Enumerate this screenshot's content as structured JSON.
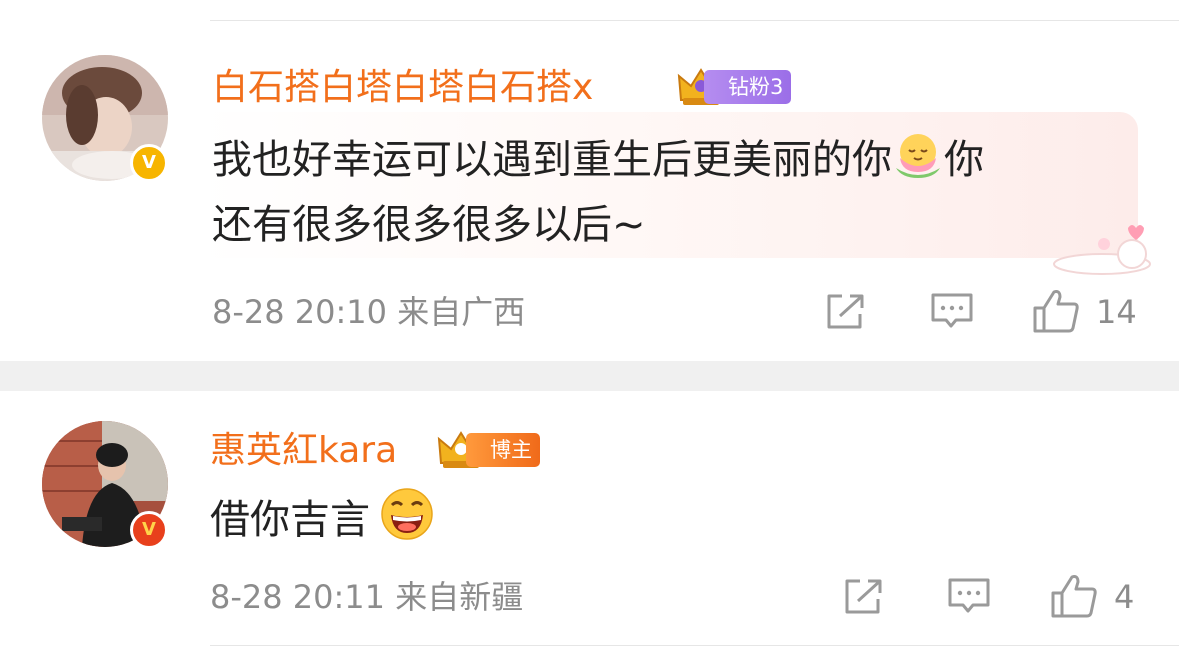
{
  "comments": [
    {
      "username": "白石搭白塔白塔白石搭x",
      "badge_label": "钻粉3",
      "badge_color": "#a47ae9",
      "verified_color": "#f7b500",
      "text_line1": "我也好幸运可以遇到重生后更美丽的你",
      "text_line2_pre": "你",
      "text_line2": "还有很多很多很多以后~",
      "emoji": "smiling-lotus-emoji",
      "time": "8-28 20:10",
      "location": "来自广西",
      "likes": "14"
    },
    {
      "username": "惠英紅kara",
      "badge_label": "博主",
      "badge_color": "#f27a22",
      "verified_color": "#e8401c",
      "text": "借你吉言",
      "emoji": "laughing-emoji",
      "time": "8-28 20:11",
      "location": "来自新疆",
      "likes": "4"
    }
  ],
  "verified_mark": "V"
}
